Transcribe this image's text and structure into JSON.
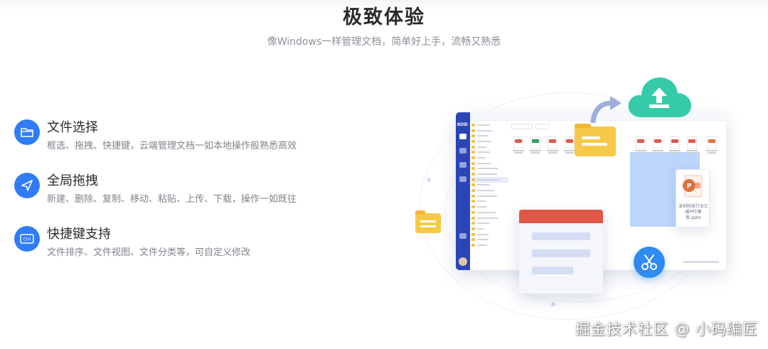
{
  "section": {
    "title": "极致体验",
    "subtitle": "像Windows一样管理文档，简单好上手，流畅又熟悉"
  },
  "features": [
    {
      "icon": "folder-icon",
      "title": "文件选择",
      "description": "框选、拖拽、快捷键，云端管理文档一如本地操作般熟悉高效"
    },
    {
      "icon": "cursor-arrow-icon",
      "title": "全局拖拽",
      "description": "新建、删除、复制、移动、粘贴、上传、下载，操作一如既往"
    },
    {
      "icon": "keyboard-ctrl-icon",
      "title": "快捷键支持",
      "description": "文件排序、文件视图、文件分类等，可自定义修改"
    }
  ],
  "illustration": {
    "app_logo": "KOD",
    "ppt_caption": "深圳科技行业汇报PPT模板.pptx"
  },
  "watermark": "掘金技术社区 @ 小码编匠",
  "colors": {
    "accent": "#2f7cf6",
    "sidebar": "#2b45b8",
    "cloud": "#36cba8",
    "card_header": "#e15745",
    "folder": "#f7c948"
  }
}
